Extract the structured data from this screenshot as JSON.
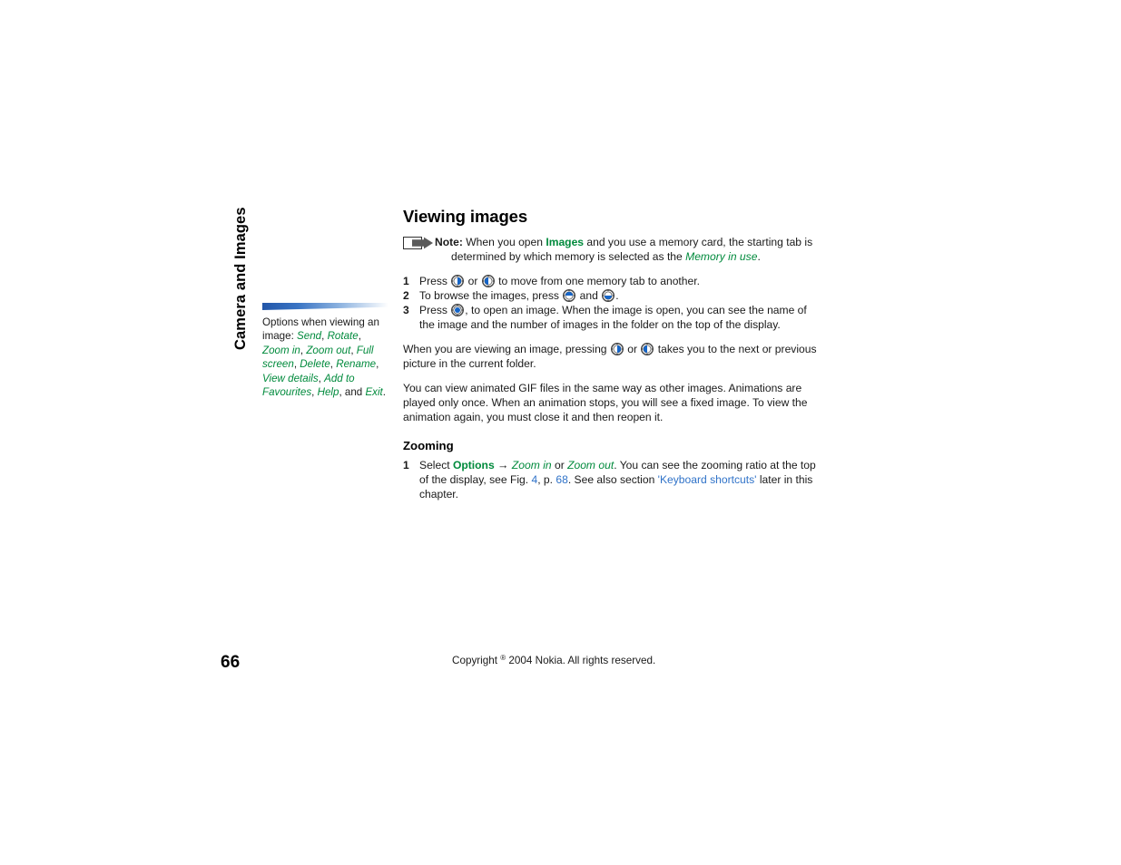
{
  "document": {
    "chapter_title": "Camera and Images",
    "page_number": "66",
    "copyright": "Copyright © 2004 Nokia. All rights reserved.",
    "copyright_prefix": "Copyright ",
    "copyright_symbol": "®",
    "copyright_suffix": " 2004 Nokia. All rights reserved."
  },
  "colors": {
    "menu_green": "#008a3c",
    "link_blue": "#2f72c8",
    "wedge_blue": "#2a63b5",
    "text_black": "#1a1a1a"
  },
  "sidebar": {
    "caption_lead": "Options when viewing an image: ",
    "caption_items": [
      "Send",
      "Rotate",
      "Zoom in",
      "Zoom out",
      "Full screen",
      "Delete",
      "Rename",
      "View details",
      "Add to Favourites",
      "Help",
      "Exit"
    ],
    "caption_full": "Options when viewing an image: Send, Rotate, Zoom in, Zoom out, Full screen, Delete, Rename, View details, Add to Favourites, Help, and Exit."
  },
  "main": {
    "heading": "Viewing images",
    "note": {
      "label": "Note:",
      "line1_a": " When you open ",
      "app_name": "Images",
      "line1_b": " and you use a memory card, the starting tab is",
      "line2_a": "determined by which memory is selected as the ",
      "setting_name": "Memory in use",
      "line2_b": "."
    },
    "steps": [
      {
        "num": "1",
        "parts": [
          "Press ",
          " or ",
          " to move from one memory tab to another."
        ],
        "icons": [
          "nav-key-left",
          "nav-key-right"
        ]
      },
      {
        "num": "2",
        "parts": [
          "To browse the images, press ",
          " and ",
          "."
        ],
        "icons": [
          "nav-key-up",
          "nav-key-down"
        ]
      },
      {
        "num": "3",
        "parts": [
          "Press ",
          ", to open an image. When the image is open, you can see the name of the image and the number of images in the folder on the top of the display."
        ],
        "icons": [
          "nav-key-center"
        ]
      }
    ],
    "paragraph_navigate": {
      "a": "When you are viewing an image, pressing ",
      "b": " or ",
      "c": " takes you to the next or previous picture in the current folder."
    },
    "paragraph_gif": "You can view animated GIF files in the same way as other images. Animations are played only once. When an animation stops, you will see a fixed image. To view the animation again, you must close it and then reopen it.",
    "zooming": {
      "heading": "Zooming",
      "step_num": "1",
      "a": "Select ",
      "options_label": "Options",
      "arrow": "→",
      "b": " ",
      "zoom_in": "Zoom in",
      "c": " or ",
      "zoom_out": "Zoom out",
      "d": ". You can see the zooming ratio at the top of the display, see Fig. ",
      "fig_num": "4",
      "e": ", p. ",
      "page_ref": "68",
      "f": ". See also section ",
      "section_ref": "'Keyboard shortcuts'",
      "g": " later in this chapter."
    }
  },
  "icons": {
    "note_arrow": "note-arrow-icon",
    "nav_key_left": "nav-key-left-icon",
    "nav_key_right": "nav-key-right-icon",
    "nav_key_up": "nav-key-up-icon",
    "nav_key_down": "nav-key-down-icon",
    "nav_key_center": "nav-key-center-icon",
    "sidebar_wedge": "sidebar-wedge-decoration"
  }
}
